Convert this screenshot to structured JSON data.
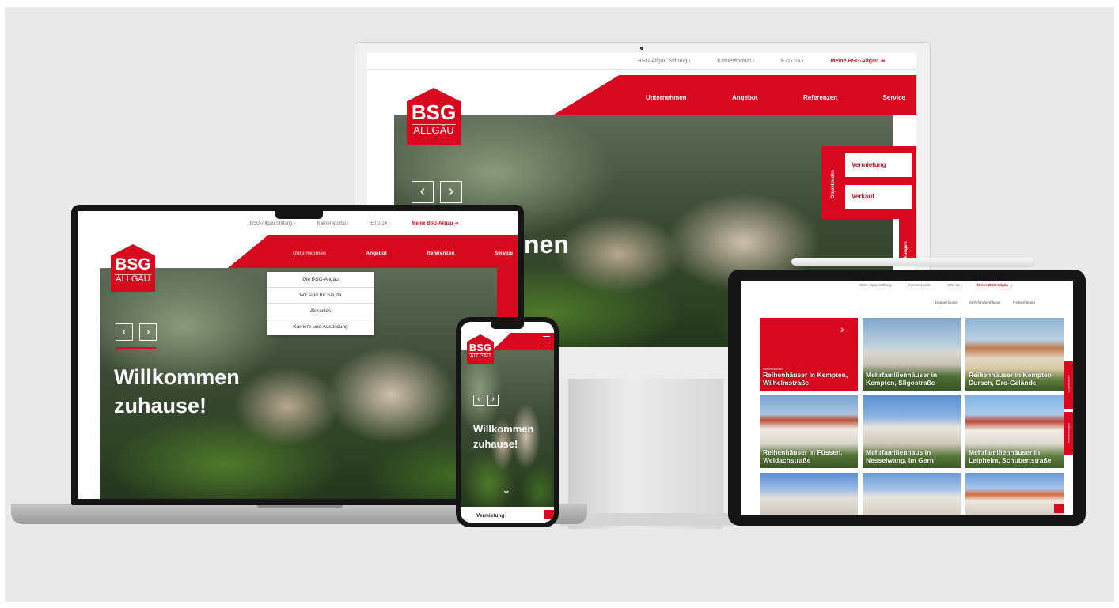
{
  "colors": {
    "brand_red": "#d6091f",
    "stage_bg": "#e9e9e9",
    "device_dark": "#151515"
  },
  "logo": {
    "line1": "BSG",
    "line2": "ALLGÄU"
  },
  "top_links": [
    "BSG-Allgäu Stiftung ›",
    "Karriereportal ›",
    "ETG 24 ›",
    "Meine BSG-Allgäu ⇥"
  ],
  "nav": [
    "Unternehmen",
    "Angebot",
    "Referenzen",
    "Service"
  ],
  "dropdown": [
    "Die BSG-Allgäu",
    "Wir sind für Sie da",
    "Aktuelles",
    "Karriere und Ausbildung"
  ],
  "hero": {
    "line1": "Willkommen",
    "line2": "zuhause!",
    "partial": "nen"
  },
  "side_panel": {
    "vertical_label": "Objektsuche",
    "vermietung": "Vermietung",
    "verkauf": "Verkauf",
    "bottom_vertical": "rkungen"
  },
  "controls": {
    "prev": "‹",
    "next": "›",
    "down": "⌄"
  },
  "phone": {
    "bottom_label": "Vermietung"
  },
  "tablet": {
    "filters": [
      "Doppelhäuser",
      "Mehrfamilienhäuser",
      "Reihenhäuser"
    ],
    "tiles": [
      {
        "tag": "Reihenhäuser",
        "caption": "Reihenhäuser in Kempten, Wilhelmstraße"
      },
      {
        "tag": "",
        "caption": "Mehrfamilienhäuser in Kempten, Sligostraße"
      },
      {
        "tag": "",
        "caption": "Reihenhäuser in Kempten-Durach, Oro-Gelände"
      },
      {
        "tag": "",
        "caption": "Reihenhäuser in Füssen, Weidachstraße"
      },
      {
        "tag": "",
        "caption": "Mehrfamilienhaus in Nesselwang, Im Gern"
      },
      {
        "tag": "",
        "caption": "Mehrfamilienhäuser in Leipheim, Schubertstraße"
      }
    ],
    "side_tabs": [
      "Objektsuche",
      "Anmerkungen"
    ]
  }
}
